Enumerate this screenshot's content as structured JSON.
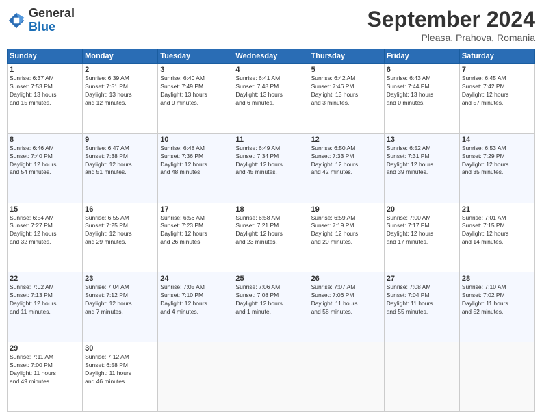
{
  "logo": {
    "general": "General",
    "blue": "Blue"
  },
  "header": {
    "month": "September 2024",
    "location": "Pleasa, Prahova, Romania"
  },
  "weekdays": [
    "Sunday",
    "Monday",
    "Tuesday",
    "Wednesday",
    "Thursday",
    "Friday",
    "Saturday"
  ],
  "weeks": [
    [
      {
        "day": "1",
        "info": "Sunrise: 6:37 AM\nSunset: 7:53 PM\nDaylight: 13 hours\nand 15 minutes."
      },
      {
        "day": "2",
        "info": "Sunrise: 6:39 AM\nSunset: 7:51 PM\nDaylight: 13 hours\nand 12 minutes."
      },
      {
        "day": "3",
        "info": "Sunrise: 6:40 AM\nSunset: 7:49 PM\nDaylight: 13 hours\nand 9 minutes."
      },
      {
        "day": "4",
        "info": "Sunrise: 6:41 AM\nSunset: 7:48 PM\nDaylight: 13 hours\nand 6 minutes."
      },
      {
        "day": "5",
        "info": "Sunrise: 6:42 AM\nSunset: 7:46 PM\nDaylight: 13 hours\nand 3 minutes."
      },
      {
        "day": "6",
        "info": "Sunrise: 6:43 AM\nSunset: 7:44 PM\nDaylight: 13 hours\nand 0 minutes."
      },
      {
        "day": "7",
        "info": "Sunrise: 6:45 AM\nSunset: 7:42 PM\nDaylight: 12 hours\nand 57 minutes."
      }
    ],
    [
      {
        "day": "8",
        "info": "Sunrise: 6:46 AM\nSunset: 7:40 PM\nDaylight: 12 hours\nand 54 minutes."
      },
      {
        "day": "9",
        "info": "Sunrise: 6:47 AM\nSunset: 7:38 PM\nDaylight: 12 hours\nand 51 minutes."
      },
      {
        "day": "10",
        "info": "Sunrise: 6:48 AM\nSunset: 7:36 PM\nDaylight: 12 hours\nand 48 minutes."
      },
      {
        "day": "11",
        "info": "Sunrise: 6:49 AM\nSunset: 7:34 PM\nDaylight: 12 hours\nand 45 minutes."
      },
      {
        "day": "12",
        "info": "Sunrise: 6:50 AM\nSunset: 7:33 PM\nDaylight: 12 hours\nand 42 minutes."
      },
      {
        "day": "13",
        "info": "Sunrise: 6:52 AM\nSunset: 7:31 PM\nDaylight: 12 hours\nand 39 minutes."
      },
      {
        "day": "14",
        "info": "Sunrise: 6:53 AM\nSunset: 7:29 PM\nDaylight: 12 hours\nand 35 minutes."
      }
    ],
    [
      {
        "day": "15",
        "info": "Sunrise: 6:54 AM\nSunset: 7:27 PM\nDaylight: 12 hours\nand 32 minutes."
      },
      {
        "day": "16",
        "info": "Sunrise: 6:55 AM\nSunset: 7:25 PM\nDaylight: 12 hours\nand 29 minutes."
      },
      {
        "day": "17",
        "info": "Sunrise: 6:56 AM\nSunset: 7:23 PM\nDaylight: 12 hours\nand 26 minutes."
      },
      {
        "day": "18",
        "info": "Sunrise: 6:58 AM\nSunset: 7:21 PM\nDaylight: 12 hours\nand 23 minutes."
      },
      {
        "day": "19",
        "info": "Sunrise: 6:59 AM\nSunset: 7:19 PM\nDaylight: 12 hours\nand 20 minutes."
      },
      {
        "day": "20",
        "info": "Sunrise: 7:00 AM\nSunset: 7:17 PM\nDaylight: 12 hours\nand 17 minutes."
      },
      {
        "day": "21",
        "info": "Sunrise: 7:01 AM\nSunset: 7:15 PM\nDaylight: 12 hours\nand 14 minutes."
      }
    ],
    [
      {
        "day": "22",
        "info": "Sunrise: 7:02 AM\nSunset: 7:13 PM\nDaylight: 12 hours\nand 11 minutes."
      },
      {
        "day": "23",
        "info": "Sunrise: 7:04 AM\nSunset: 7:12 PM\nDaylight: 12 hours\nand 7 minutes."
      },
      {
        "day": "24",
        "info": "Sunrise: 7:05 AM\nSunset: 7:10 PM\nDaylight: 12 hours\nand 4 minutes."
      },
      {
        "day": "25",
        "info": "Sunrise: 7:06 AM\nSunset: 7:08 PM\nDaylight: 12 hours\nand 1 minute."
      },
      {
        "day": "26",
        "info": "Sunrise: 7:07 AM\nSunset: 7:06 PM\nDaylight: 11 hours\nand 58 minutes."
      },
      {
        "day": "27",
        "info": "Sunrise: 7:08 AM\nSunset: 7:04 PM\nDaylight: 11 hours\nand 55 minutes."
      },
      {
        "day": "28",
        "info": "Sunrise: 7:10 AM\nSunset: 7:02 PM\nDaylight: 11 hours\nand 52 minutes."
      }
    ],
    [
      {
        "day": "29",
        "info": "Sunrise: 7:11 AM\nSunset: 7:00 PM\nDaylight: 11 hours\nand 49 minutes."
      },
      {
        "day": "30",
        "info": "Sunrise: 7:12 AM\nSunset: 6:58 PM\nDaylight: 11 hours\nand 46 minutes."
      },
      null,
      null,
      null,
      null,
      null
    ]
  ]
}
